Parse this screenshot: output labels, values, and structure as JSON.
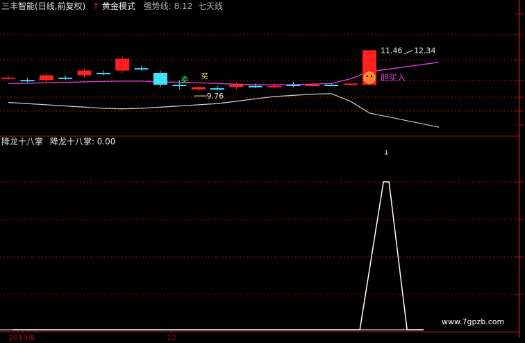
{
  "header": {
    "title": "三丰智能(日线,前复权)",
    "indicator_arrow": "↑",
    "indicator_name": "黄金模式",
    "strength_label": "强势线: 8.12",
    "extra_label": "七天线"
  },
  "lower_header": {
    "title": "降龙十八掌",
    "value_label": "降龙十八掌: 0.00"
  },
  "watermark": "www.7gpzb.com",
  "bottom_labels": {
    "year": "2013年",
    "month": "12"
  },
  "colors": {
    "background": "#000000",
    "grid_red": "#b01010",
    "up_red": "#ff2020",
    "down_cyan": "#40e0ff",
    "magenta": "#e040e0",
    "white_line": "#ffffff",
    "yellow": "#ffff40",
    "green": "#40ff40",
    "gray_line": "#c8c8c8"
  },
  "chart_data": [
    {
      "type": "candlestick",
      "title": "三丰智能(日线,前复权)",
      "annotations": {
        "high_label": "11.46",
        "high_target_label": "12.34",
        "low_label": "9.76",
        "buy_signal": "胆买入",
        "sell_marker": "卖",
        "buy_marker": "买"
      },
      "ylim": [
        8.0,
        13.0
      ],
      "candles": [
        {
          "o": 10.3,
          "c": 10.3,
          "h": 10.4,
          "l": 10.2
        },
        {
          "o": 10.2,
          "c": 10.2,
          "h": 10.3,
          "l": 10.1
        },
        {
          "o": 10.2,
          "c": 10.4,
          "h": 10.5,
          "l": 10.1
        },
        {
          "o": 10.3,
          "c": 10.3,
          "h": 10.4,
          "l": 10.2
        },
        {
          "o": 10.4,
          "c": 10.6,
          "h": 10.7,
          "l": 10.3
        },
        {
          "o": 10.5,
          "c": 10.5,
          "h": 10.6,
          "l": 10.4
        },
        {
          "o": 10.6,
          "c": 11.1,
          "h": 11.2,
          "l": 10.5
        },
        {
          "o": 10.7,
          "c": 10.7,
          "h": 10.8,
          "l": 10.6
        },
        {
          "o": 10.5,
          "c": 10.0,
          "h": 10.6,
          "l": 9.9
        },
        {
          "o": 10.0,
          "c": 10.0,
          "h": 10.2,
          "l": 9.8
        },
        {
          "o": 9.8,
          "c": 9.9,
          "h": 9.95,
          "l": 9.76
        },
        {
          "o": 9.85,
          "c": 9.85,
          "h": 9.95,
          "l": 9.75
        },
        {
          "o": 9.9,
          "c": 10.0,
          "h": 10.1,
          "l": 9.8
        },
        {
          "o": 9.95,
          "c": 9.95,
          "h": 10.05,
          "l": 9.85
        },
        {
          "o": 9.95,
          "c": 9.95,
          "h": 10.05,
          "l": 9.85
        },
        {
          "o": 10.0,
          "c": 10.0,
          "h": 10.1,
          "l": 9.9
        },
        {
          "o": 10.0,
          "c": 10.0,
          "h": 10.1,
          "l": 9.9
        },
        {
          "o": 10.0,
          "c": 10.0,
          "h": 10.05,
          "l": 9.95
        },
        {
          "o": 10.0,
          "c": 10.05,
          "h": 10.1,
          "l": 9.95
        },
        {
          "o": 10.0,
          "c": 11.46,
          "h": 11.46,
          "l": 9.95
        }
      ],
      "series": [
        {
          "name": "强势线",
          "color": "#e040e0",
          "values": [
            10.05,
            10.06,
            10.08,
            10.1,
            10.12,
            10.14,
            10.15,
            10.15,
            10.12,
            10.1,
            10.08,
            10.05,
            10.02,
            10.0,
            10.0,
            10.0,
            10.02,
            10.05,
            10.25,
            10.55
          ]
        },
        {
          "name": "七天线",
          "color": "#c8c8c8",
          "values": [
            9.25,
            9.2,
            9.15,
            9.1,
            9.05,
            9.0,
            8.98,
            9.0,
            9.05,
            9.1,
            9.15,
            9.2,
            9.3,
            9.4,
            9.5,
            9.55,
            9.6,
            9.62,
            9.3,
            8.8
          ]
        }
      ]
    },
    {
      "type": "line",
      "title": "降龙十八掌",
      "ylim": [
        0,
        100
      ],
      "x": [
        0,
        1,
        2,
        3,
        4,
        5,
        6,
        7,
        8,
        9,
        10,
        11,
        12,
        13,
        14,
        15,
        16,
        17,
        18,
        19,
        20,
        21,
        22
      ],
      "values": [
        0,
        0,
        0,
        0,
        0,
        0,
        0,
        0,
        0,
        0,
        0,
        0,
        0,
        0,
        0,
        0,
        0,
        0,
        0,
        0,
        100,
        0,
        0
      ],
      "series_name": "降龙十八掌"
    }
  ]
}
